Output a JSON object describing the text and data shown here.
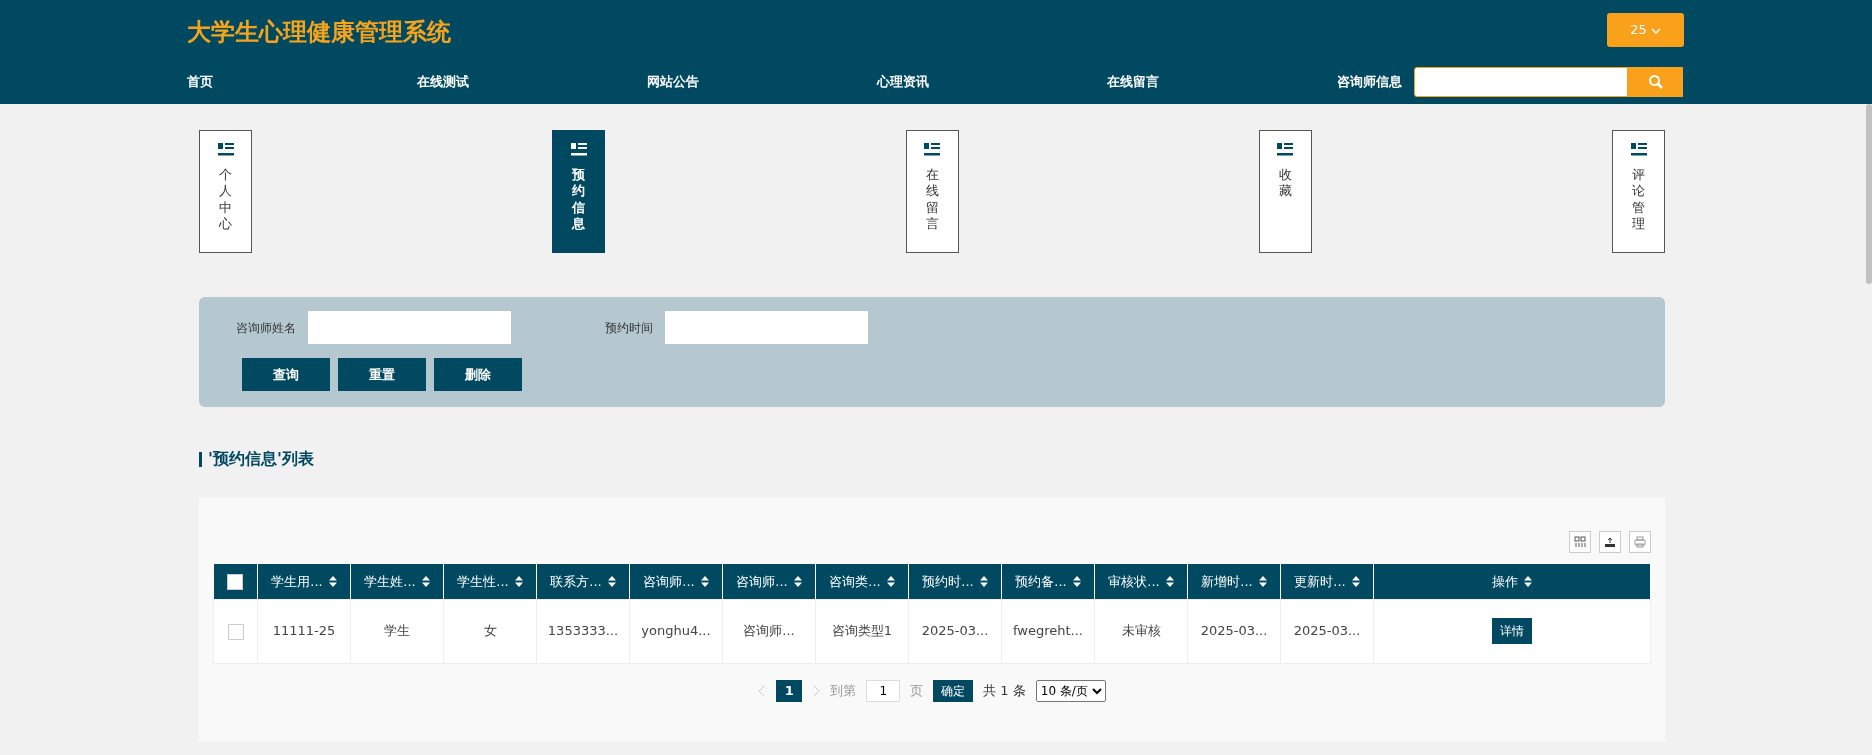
{
  "header": {
    "title": "大学生心理健康管理系统",
    "user_menu": "25",
    "nav": [
      {
        "label": "首页"
      },
      {
        "label": "在线测试"
      },
      {
        "label": "网站公告"
      },
      {
        "label": "心理资讯"
      },
      {
        "label": "在线留言"
      },
      {
        "label": "咨询师信息"
      }
    ]
  },
  "side_tabs": [
    {
      "label": "个人中心",
      "selected": false
    },
    {
      "label": "预约信息",
      "selected": true
    },
    {
      "label": "在线留言",
      "selected": false
    },
    {
      "label": "收藏",
      "selected": false
    },
    {
      "label": "评论管理",
      "selected": false
    }
  ],
  "filters": {
    "fields": [
      {
        "label": "咨询师姓名"
      },
      {
        "label": "预约时间"
      }
    ],
    "buttons": [
      "查询",
      "重置",
      "删除"
    ]
  },
  "list_title": "'预约信息'列表",
  "table": {
    "select_all": {
      "checked": false
    },
    "columns": [
      "学生用...",
      "学生姓...",
      "学生性...",
      "联系方...",
      "咨询师...",
      "咨询师...",
      "咨询类...",
      "预约时...",
      "预约备...",
      "审核状...",
      "新增时...",
      "更新时...",
      "操作"
    ],
    "rows": [
      {
        "checked": false,
        "cells": [
          "11111-25",
          "学生",
          "女",
          "1353333...",
          "yonghu4...",
          "咨询师...",
          "咨询类型1",
          "2025-03...",
          "fwegreht...",
          "未审核",
          "2025-03...",
          "2025-03..."
        ],
        "action": "详情"
      }
    ]
  },
  "pagination": {
    "pages": [
      {
        "label": "1",
        "selected": true
      }
    ],
    "goto_label": "到第",
    "goto_value": "1",
    "page_unit": "页",
    "confirm": "确定",
    "total": "共 1 条",
    "page_size": "10 条/页"
  }
}
